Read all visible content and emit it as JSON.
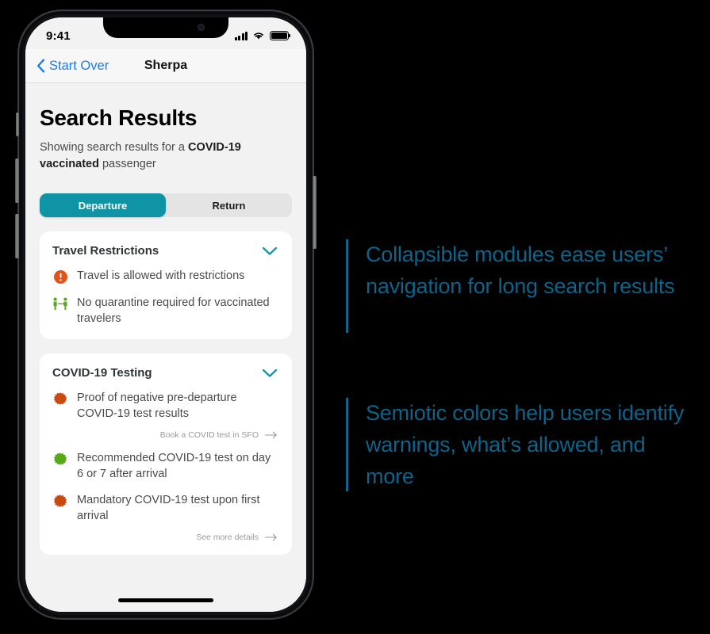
{
  "phone": {
    "status_bar": {
      "time": "9:41",
      "signal_icon": "cellular-signal-icon",
      "wifi_icon": "wifi-icon",
      "battery_icon": "battery-icon"
    },
    "nav": {
      "back_label": "Start Over",
      "back_icon": "chevron-left-icon",
      "title": "Sherpa"
    },
    "home_indicator": "home-indicator"
  },
  "main": {
    "title": "Search Results",
    "subtitle_parts": [
      {
        "text": "Showing search results for a ",
        "bold": false
      },
      {
        "text": "COVID-19 vaccinated",
        "bold": true
      },
      {
        "text": " passenger",
        "bold": false
      }
    ],
    "segmented_control": {
      "options": [
        {
          "label": "Departure",
          "active": true
        },
        {
          "label": "Return",
          "active": false
        }
      ]
    },
    "cards": [
      {
        "title": "Travel Restrictions",
        "chevron_icon": "chevron-down-icon",
        "rows": [
          {
            "icon": "warning-exclamation-icon",
            "icon_color": "#e0541a",
            "text": "Travel is allowed with restrictions"
          },
          {
            "icon": "social-distancing-people-icon",
            "icon_color": "#5aa81e",
            "text": "No quarantine required for vaccinated travelers"
          }
        ],
        "links": []
      },
      {
        "title": "COVID-19 Testing",
        "chevron_icon": "chevron-down-icon",
        "rows": [
          {
            "icon": "virus-icon",
            "icon_color": "#c94a10",
            "text": "Proof of negative pre-departure COVID-19 test results",
            "link": {
              "label": "Book a COVID test in SFO",
              "icon": "arrow-right-icon"
            }
          },
          {
            "icon": "virus-icon",
            "icon_color": "#58a818",
            "text": "Recommended COVID-19 test on day 6 or 7 after arrival"
          },
          {
            "icon": "virus-icon",
            "icon_color": "#c94a10",
            "text": "Mandatory COVID-19 test upon first arrival",
            "link": {
              "label": "See more details",
              "icon": "arrow-right-icon"
            }
          }
        ]
      }
    ]
  },
  "annotations": [
    {
      "text": "Collapsible modules ease users’ navigation for long search results"
    },
    {
      "text": "Semiotic colors help users identify warnings, what’s allowed, and more"
    }
  ],
  "colors": {
    "accent_teal": "#0e94a4",
    "link_blue": "#1a7cf0",
    "annotation_blue": "#0e6389",
    "warning_orange": "#e0541a",
    "allowed_green": "#5aa81e",
    "background": "#000000",
    "screen_bg": "#f2f2f2",
    "card_bg": "#ffffff"
  }
}
